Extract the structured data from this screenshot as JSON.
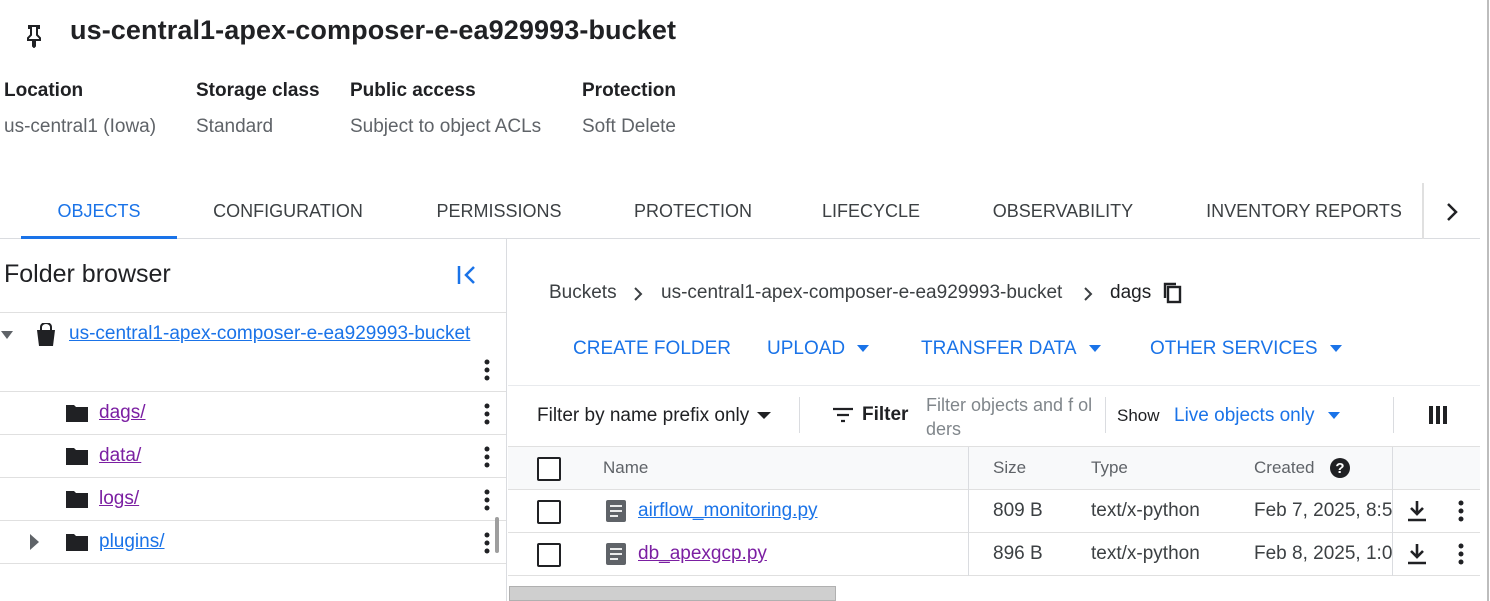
{
  "header": {
    "title": "us-central1-apex-composer-e-ea929993-bucket",
    "pin_icon": "pin-icon"
  },
  "meta": {
    "location": {
      "label": "Location",
      "value": "us-central1 (Iowa)"
    },
    "storage_class": {
      "label": "Storage class",
      "value": "Standard"
    },
    "public_access": {
      "label": "Public access",
      "value": "Subject to object ACLs"
    },
    "protection": {
      "label": "Protection",
      "value": "Soft Delete"
    }
  },
  "tabs": [
    {
      "label": "OBJECTS",
      "active": true
    },
    {
      "label": "CONFIGURATION"
    },
    {
      "label": "PERMISSIONS"
    },
    {
      "label": "PROTECTION"
    },
    {
      "label": "LIFECYCLE"
    },
    {
      "label": "OBSERVABILITY"
    },
    {
      "label": "INVENTORY REPORTS"
    }
  ],
  "folder_browser": {
    "title": "Folder browser",
    "bucket": "us-central1-apex-composer-e-ea929993-bucket",
    "folders": [
      "dags/",
      "data/",
      "logs/",
      "plugins/"
    ]
  },
  "breadcrumb": {
    "root": "Buckets",
    "bucket": "us-central1-apex-composer-e-ea929993-bucket",
    "current": "dags"
  },
  "actions": {
    "create_folder": "CREATE FOLDER",
    "upload": "UPLOAD",
    "transfer_data": "TRANSFER DATA",
    "other_services": "OTHER SERVICES"
  },
  "filter": {
    "prefix_mode": "Filter by name prefix only",
    "button": "Filter",
    "placeholder": "Filter objects and f olders",
    "show_label": "Show",
    "show_value": "Live objects only"
  },
  "table": {
    "columns": {
      "name": "Name",
      "size": "Size",
      "type": "Type",
      "created": "Created"
    },
    "rows": [
      {
        "name": "airflow_monitoring.py",
        "size": "809 B",
        "type": "text/x-python",
        "created": "Feb 7, 2025, 8:5"
      },
      {
        "name": "db_apexgcp.py",
        "size": "896 B",
        "type": "text/x-python",
        "created": "Feb 8, 2025, 1:0"
      }
    ]
  },
  "colors": {
    "accent": "#1a73e8",
    "visited_link": "#7b1fa2",
    "text": "#202124",
    "muted": "#5f6368"
  }
}
